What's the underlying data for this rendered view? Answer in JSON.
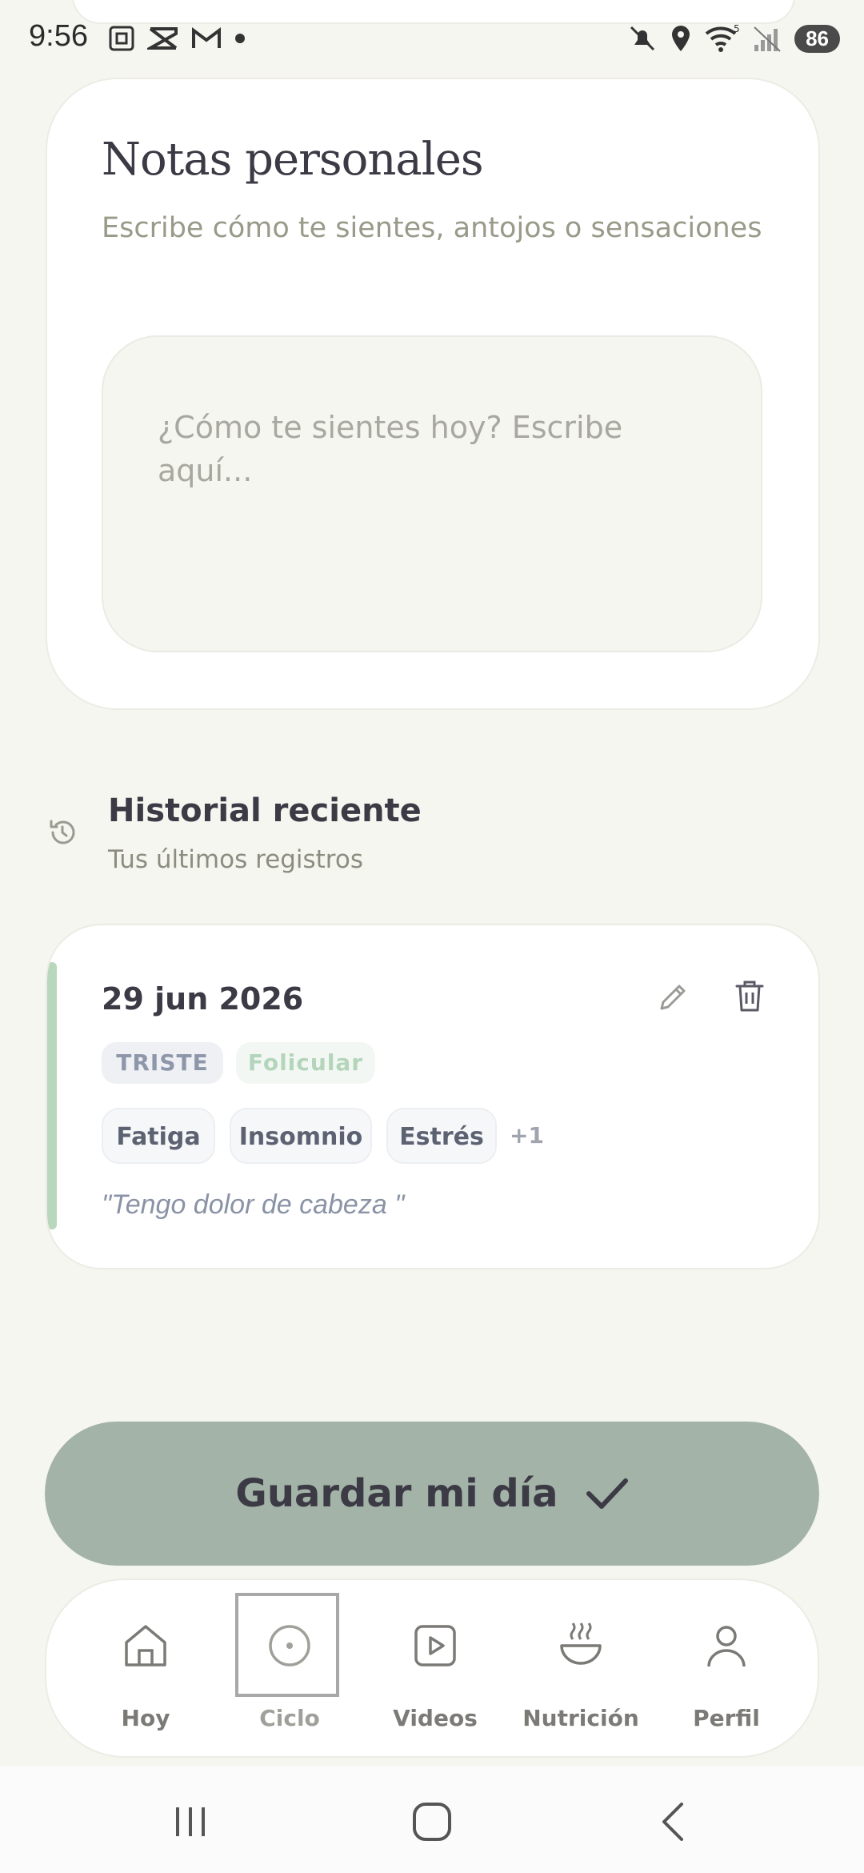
{
  "status_bar": {
    "time": "9:56",
    "battery": "86",
    "left_icons": [
      "screenshot-icon",
      "capcut-icon",
      "gmail-icon",
      "dot-icon"
    ],
    "right_icons": [
      "mute-icon",
      "location-icon",
      "wifi-icon",
      "signal-icon"
    ]
  },
  "notes": {
    "title": "Notas personales",
    "subtitle": "Escribe cómo te sientes, antojos o sensaciones",
    "placeholder": "¿Cómo te sientes hoy? Escribe aquí..."
  },
  "history": {
    "title": "Historial reciente",
    "subtitle": "Tus últimos registros",
    "icon": "history-icon",
    "entries": [
      {
        "date": "29 jun 2026",
        "mood": "TRISTE",
        "phase": "Folicular",
        "symptoms": [
          "Fatiga",
          "Insomnio",
          "Estrés"
        ],
        "more": "+1",
        "note": "\"Tengo dolor de cabeza \""
      }
    ]
  },
  "save_button": {
    "label": "Guardar mi día",
    "color": "#a3b3a7"
  },
  "nav": {
    "items": [
      {
        "label": "Hoy",
        "icon": "home-icon"
      },
      {
        "label": "Ciclo",
        "icon": "cycle-icon",
        "active": true
      },
      {
        "label": "Videos",
        "icon": "video-icon"
      },
      {
        "label": "Nutrición",
        "icon": "bowl-icon"
      },
      {
        "label": "Perfil",
        "icon": "user-icon"
      }
    ]
  },
  "colors": {
    "background": "#f6f6f1",
    "accent": "#b8d7bd",
    "text": "#3b3a45"
  }
}
